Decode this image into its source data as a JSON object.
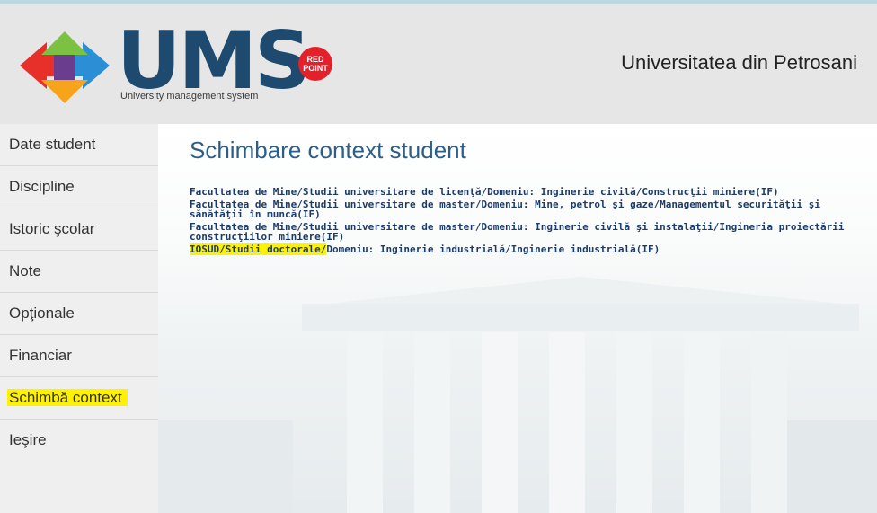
{
  "header": {
    "logo_text": "UMS",
    "logo_subtitle": "University management system",
    "badge_line1": "RED",
    "badge_line2": "POINT",
    "university_name": "Universitatea din Petrosani"
  },
  "sidebar": {
    "items": [
      {
        "label": "Date student"
      },
      {
        "label": "Discipline"
      },
      {
        "label": "Istoric şcolar"
      },
      {
        "label": "Note"
      },
      {
        "label": "Opţionale"
      },
      {
        "label": "Financiar"
      },
      {
        "label": "Schimbă context",
        "highlighted": true
      },
      {
        "label": "Ieşire"
      }
    ]
  },
  "main": {
    "title": "Schimbare context student",
    "contexts": [
      {
        "text": "Facultatea de Mine/Studii universitare de licenţă/Domeniu: Inginerie civilă/Construcţii miniere(IF)"
      },
      {
        "text": "Facultatea de Mine/Studii universitare de master/Domeniu: Mine, petrol şi gaze/Managementul securităţii şi sănătăţii în muncă(IF)"
      },
      {
        "text": "Facultatea de Mine/Studii universitare de master/Domeniu: Inginerie civilă şi instalaţii/Ingineria proiectării construcţiilor miniere(IF)"
      },
      {
        "highlight": "IOSUD/Studii doctorale/",
        "rest": "Domeniu: Inginerie industrială/Inginerie industrială(IF)"
      }
    ]
  },
  "colors": {
    "logo_blue": "#1d4a6e",
    "title_blue": "#2b5f8a",
    "link_blue": "#1a3b6b",
    "highlight": "#fff200",
    "badge_red": "#e4202a"
  }
}
